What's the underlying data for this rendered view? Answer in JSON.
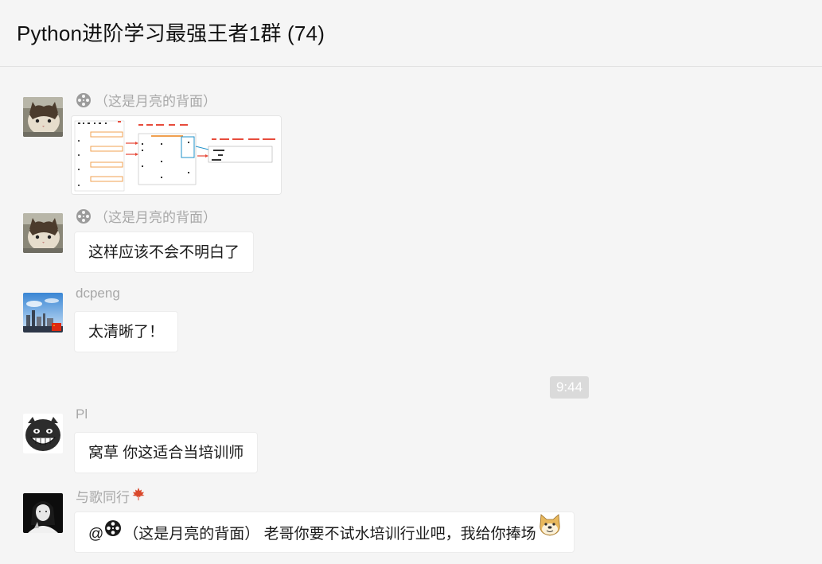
{
  "header": {
    "title": "Python进阶学习最强王者1群 (74)"
  },
  "messages": [
    {
      "sender": "（这是月亮的背面）",
      "type": "image"
    },
    {
      "sender": "（这是月亮的背面）",
      "text": "这样应该不会不明白了"
    },
    {
      "sender": "dcpeng",
      "text": "太清晰了！"
    },
    {
      "sender": "Pl",
      "text": "窝草  你这适合当培训师"
    },
    {
      "sender": "与歌同行",
      "text_prefix": "@",
      "mention": "（这是月亮的背面）",
      "text": " 老哥你要不试水培训行业吧，我给你捧场"
    }
  ],
  "time_divider": "9:44",
  "icons": {
    "film_reel": "film-reel-icon",
    "maple_leaf": "maple-leaf-icon",
    "doge": "doge-emoji-icon"
  },
  "colors": {
    "background": "#f5f5f5",
    "bubble": "#ffffff",
    "sender_text": "#a8a8a8",
    "time_badge": "#dadada"
  }
}
